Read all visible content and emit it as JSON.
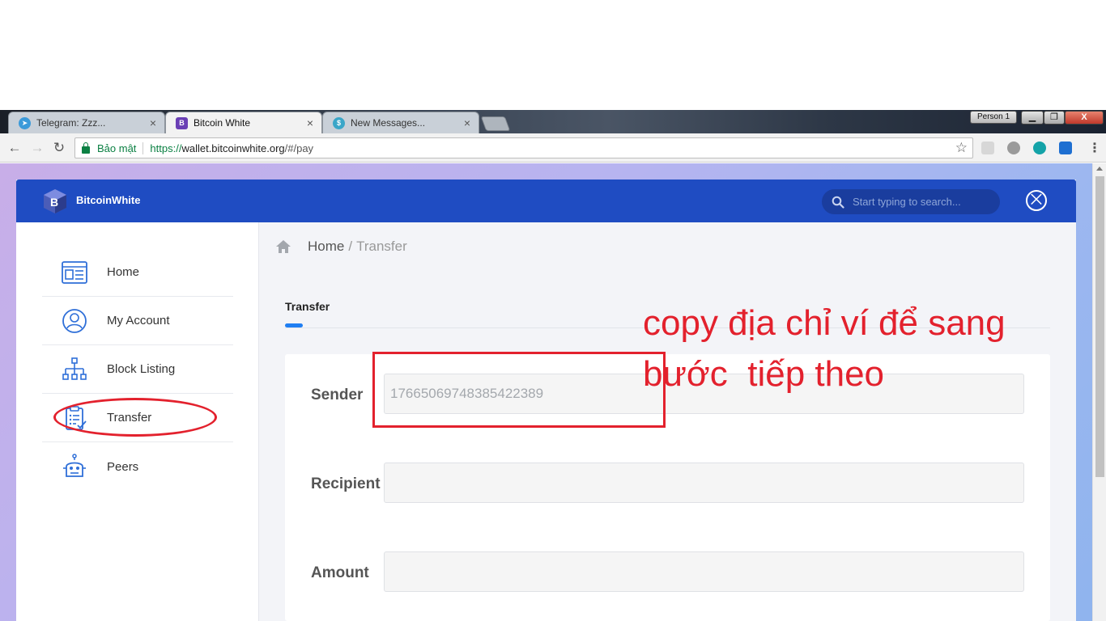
{
  "browser": {
    "tabs": [
      {
        "title": "Telegram: Zzz...",
        "icon": "telegram-icon",
        "active": false
      },
      {
        "title": "Bitcoin White",
        "icon": "bitcoinwhite-icon",
        "active": true
      },
      {
        "title": "New Messages...",
        "icon": "dollar-icon",
        "active": false
      }
    ],
    "close_glyph": "×",
    "person_label": "Person 1",
    "window_buttons": {
      "minimize": "▁",
      "maximize": "❐",
      "close": "X"
    },
    "security_label": "Bảo mật",
    "url_scheme": "https://",
    "url_host": "wallet.bitcoinwhite.org",
    "url_path": "/#/pay"
  },
  "app": {
    "brand": "BitcoinWhite",
    "search_placeholder": "Start typing to search...",
    "close_glyph": "⨉",
    "colors": {
      "topbar": "#1f4cc2",
      "accent": "#1f7ef2",
      "annotation": "#e3212d"
    }
  },
  "sidebar": {
    "items": [
      {
        "label": "Home",
        "icon": "dashboard-icon"
      },
      {
        "label": "My Account",
        "icon": "user-icon"
      },
      {
        "label": "Block Listing",
        "icon": "hierarchy-icon"
      },
      {
        "label": "Transfer",
        "icon": "clipboard-check-icon"
      },
      {
        "label": "Peers",
        "icon": "robot-icon"
      }
    ]
  },
  "breadcrumb": {
    "home": "Home",
    "separator": "/",
    "current": "Transfer"
  },
  "tabs": {
    "active": "Transfer"
  },
  "form": {
    "sender_label": "Sender",
    "sender_value": "17665069748385422389",
    "recipient_label": "Recipient",
    "recipient_value": "",
    "amount_label": "Amount",
    "amount_value": ""
  },
  "annotation": {
    "line1": "copy địa chỉ ví để sang",
    "line2": "bước  tiếp theo"
  }
}
